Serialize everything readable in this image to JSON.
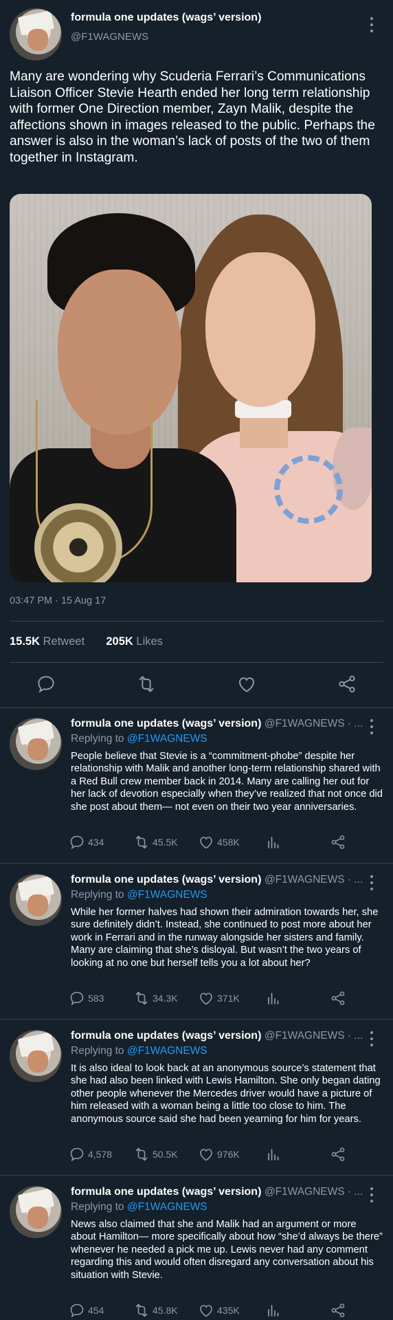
{
  "colors": {
    "background": "#15202b",
    "text": "#ffffff",
    "secondary": "#8b98a5",
    "accent": "#1d9bf0",
    "border": "#38444d"
  },
  "main_tweet": {
    "author_name": "formula one updates (wags’ version)",
    "handle": "@F1WAGNEWS",
    "text": "Many are wondering why Scuderia Ferrari’s Communications Liaison Officer Stevie Hearth ended her long term relationship with former One Direction member, Zayn Malik, despite the affections shown in images released to the public. Perhaps the answer is also in the woman’s lack of posts of the two of them together in Instagram.",
    "timestamp": "03:47 PM · 15 Aug 17",
    "retweets_count": "15.5K",
    "retweets_label": "Retweet",
    "likes_count": "205K",
    "likes_label": "Likes",
    "icons": [
      "reply-icon",
      "retweet-icon",
      "like-icon",
      "share-icon"
    ]
  },
  "replies": [
    {
      "author_name": "formula one updates (wags’ version)",
      "handle": "@F1WAGNEWS · ...",
      "replying_label": "Replying to",
      "replying_to": "@F1WAGNEWS",
      "text": "People believe that Stevie is a “commitment-phobe” despite her relationship with Malik and another long-term relationship shared with a Red Bull crew member back in 2014. Many are calling her out for her lack of devotion especially when they’ve realized that not once did she post about them— not even on their two year anniversaries.",
      "reply_count": "434",
      "retweet_count": "45.5K",
      "like_count": "458K"
    },
    {
      "author_name": "formula one updates (wags’ version)",
      "handle": "@F1WAGNEWS · ...",
      "replying_label": "Replying to",
      "replying_to": "@F1WAGNEWS",
      "text": "While her former halves had shown their admiration towards her, she sure definitely didn’t. Instead, she continued to post more about her work in Ferrari and in the runway alongside her sisters and family. Many are claiming that she’s disloyal. But wasn’t the two years of looking at no one but herself tells you a lot about her?",
      "reply_count": "583",
      "retweet_count": "34.3K",
      "like_count": "371K"
    },
    {
      "author_name": "formula one updates (wags’ version)",
      "handle": "@F1WAGNEWS · ...",
      "replying_label": "Replying to",
      "replying_to": "@F1WAGNEWS",
      "text": "It is also ideal to look back at an anonymous source’s statement that she had also been linked with Lewis Hamilton. She only began dating other people whenever the Mercedes driver would have a picture of him released with a woman being a little too close to him. The anonymous source said she had been yearning for him for years.",
      "reply_count": "4,578",
      "retweet_count": "50.5K",
      "like_count": "976K"
    },
    {
      "author_name": "formula one updates (wags’ version)",
      "handle": "@F1WAGNEWS · ...",
      "replying_label": "Replying to",
      "replying_to": "@F1WAGNEWS",
      "text": "News also claimed that she and Malik had an argument or more about Hamilton— more specifically about how “she’d always be there” whenever he needed a pick me up. Lewis never had any comment regarding this and would often disregard any conversation about his situation with Stevie.",
      "reply_count": "454",
      "retweet_count": "45.8K",
      "like_count": "435K"
    }
  ]
}
